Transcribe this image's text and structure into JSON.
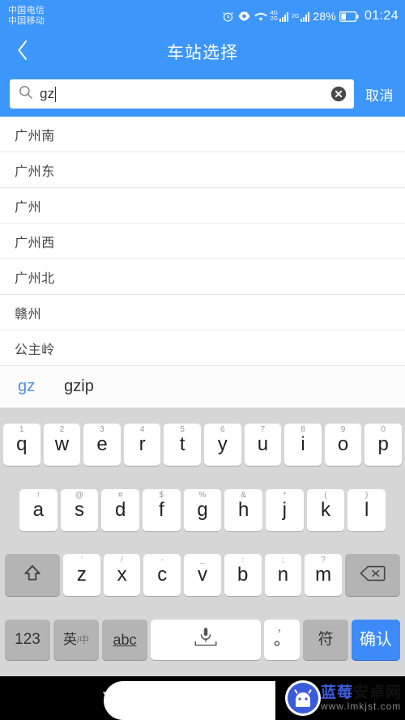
{
  "status_bar": {
    "carriers": [
      "中国电信",
      "中国移动"
    ],
    "icons": [
      "alarm-icon",
      "eye-icon",
      "wifi-icon",
      "signal-4g-icon",
      "signal-2g-icon"
    ],
    "net_label_1_top": "4G",
    "net_label_1_bottom": "2G",
    "net_label_2": "2G",
    "battery_percent": "28%",
    "time": "01:24"
  },
  "title_bar": {
    "back_icon": "chevron-left-icon",
    "title": "车站选择"
  },
  "search": {
    "icon": "search-icon",
    "value": "gz",
    "placeholder": "",
    "clear_icon": "clear-circle-icon",
    "cancel_label": "取消"
  },
  "results": [
    {
      "name": "广州南"
    },
    {
      "name": "广州东"
    },
    {
      "name": "广州"
    },
    {
      "name": "广州西"
    },
    {
      "name": "广州北"
    },
    {
      "name": "赣州"
    },
    {
      "name": "公主岭"
    }
  ],
  "candidates": [
    {
      "text": "gz",
      "active": true
    },
    {
      "text": "gzip",
      "active": false
    }
  ],
  "keyboard": {
    "row1": [
      {
        "main": "q",
        "sup": "1"
      },
      {
        "main": "w",
        "sup": "2"
      },
      {
        "main": "e",
        "sup": "3"
      },
      {
        "main": "r",
        "sup": "4"
      },
      {
        "main": "t",
        "sup": "5"
      },
      {
        "main": "y",
        "sup": "6"
      },
      {
        "main": "u",
        "sup": "7"
      },
      {
        "main": "i",
        "sup": "8"
      },
      {
        "main": "o",
        "sup": "9"
      },
      {
        "main": "p",
        "sup": "0"
      }
    ],
    "row2": [
      {
        "main": "a",
        "sup": "!"
      },
      {
        "main": "s",
        "sup": "@"
      },
      {
        "main": "d",
        "sup": "#"
      },
      {
        "main": "f",
        "sup": "$"
      },
      {
        "main": "g",
        "sup": "%"
      },
      {
        "main": "h",
        "sup": "&"
      },
      {
        "main": "j",
        "sup": "*"
      },
      {
        "main": "k",
        "sup": "("
      },
      {
        "main": "l",
        "sup": ")"
      }
    ],
    "row3": {
      "shift_icon": "shift-up-icon",
      "letters": [
        {
          "main": "z",
          "sup": "’"
        },
        {
          "main": "x",
          "sup": "/"
        },
        {
          "main": "c",
          "sup": "-"
        },
        {
          "main": "v",
          "sup": "_"
        },
        {
          "main": "b",
          "sup": ":"
        },
        {
          "main": "n",
          "sup": ";"
        },
        {
          "main": "m",
          "sup": "?"
        }
      ],
      "backspace_icon": "backspace-icon"
    },
    "row4": {
      "numeric_label": "123",
      "lang_label": "英",
      "lang_sub": "/中",
      "abc_label": "abc",
      "space_icon": "microphone-icon",
      "punct_main": "。",
      "punct_sup": "，",
      "symbol_label": "符",
      "enter_label": "确认"
    }
  },
  "nav_bar": {
    "back_icon": "nav-back-triangle-icon",
    "home_icon": "nav-home-circle-icon"
  },
  "watermark": {
    "logo_icon": "android-robot-icon",
    "title_part1": "蓝莓",
    "title_part2": "安卓网",
    "url": "www.lmkjst.com"
  },
  "colors": {
    "brand_blue": "#3d96fa",
    "keyboard_bg": "#d6d6d6",
    "key_white": "#ffffff",
    "key_gray": "#b4b4b4",
    "enter_blue": "#3d8bfa",
    "candidate_active": "#4a90e2",
    "list_text": "#444444",
    "navbar_bg": "#000000"
  }
}
